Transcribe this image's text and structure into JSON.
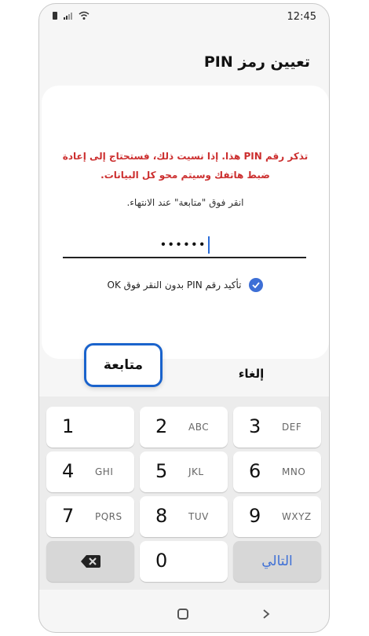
{
  "status": {
    "time": "12:45"
  },
  "header": {
    "title": "تعيين رمز PIN"
  },
  "card": {
    "warning": "تذكر رقم PIN هذا. إذا نسيت ذلك، فستحتاج إلى إعادة ضبط هاتفك وسيتم محو كل البيانات.",
    "hint": "انقر فوق \"متابعة\" عند الانتهاء.",
    "pin_masked": "••••••",
    "confirm_label": "تأكيد رقم PIN بدون النقر فوق OK"
  },
  "actions": {
    "continue_label": "متابعة",
    "cancel_label": "إلغاء"
  },
  "keypad": {
    "keys": [
      {
        "num": "1",
        "letters": ""
      },
      {
        "num": "2",
        "letters": "ABC"
      },
      {
        "num": "3",
        "letters": "DEF"
      },
      {
        "num": "4",
        "letters": "GHI"
      },
      {
        "num": "5",
        "letters": "JKL"
      },
      {
        "num": "6",
        "letters": "MNO"
      },
      {
        "num": "7",
        "letters": "PQRS"
      },
      {
        "num": "8",
        "letters": "TUV"
      },
      {
        "num": "9",
        "letters": "WXYZ"
      },
      {
        "num": "0",
        "letters": ""
      }
    ],
    "next_label": "التالي"
  },
  "colors": {
    "warning": "#cc2f2f",
    "accent": "#3d6fd6",
    "highlight_border": "#1a63cc"
  },
  "icons": {
    "backspace": "backspace-icon",
    "home": "home-icon",
    "back": "back-icon"
  }
}
